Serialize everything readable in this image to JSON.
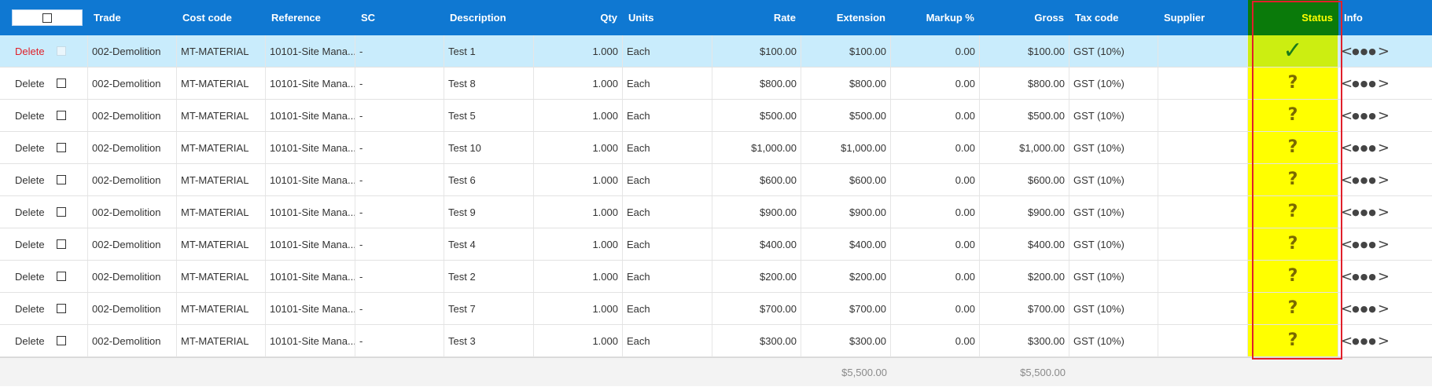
{
  "columns": {
    "trade": "Trade",
    "cost_code": "Cost code",
    "reference": "Reference",
    "sc": "SC",
    "description": "Description",
    "qty": "Qty",
    "units": "Units",
    "rate": "Rate",
    "extension": "Extension",
    "markup": "Markup %",
    "gross": "Gross",
    "tax_code": "Tax code",
    "supplier": "Supplier",
    "status": "Status",
    "info": "Info"
  },
  "delete_label": "Delete",
  "colors": {
    "header_bg": "#0f78d2",
    "status_header_bg": "#0a7a0a",
    "status_header_text": "#ffff00",
    "status_cell_bg": "#ffff00",
    "selected_row_bg": "#c9ecfc",
    "delete_selected": "#e0202a"
  },
  "rows": [
    {
      "trade": "002-Demolition",
      "cost_code": "MT-MATERIAL",
      "reference": "10101-Site Mana...",
      "sc": "-",
      "description": "Test 1",
      "qty": "1.000",
      "units": "Each",
      "rate": "$100.00",
      "extension": "$100.00",
      "markup": "0.00",
      "gross": "$100.00",
      "tax_code": "GST (10%)",
      "supplier": "",
      "status_icon": "check-icon",
      "status_glyph": "✓"
    },
    {
      "trade": "002-Demolition",
      "cost_code": "MT-MATERIAL",
      "reference": "10101-Site Mana...",
      "sc": "-",
      "description": "Test 8",
      "qty": "1.000",
      "units": "Each",
      "rate": "$800.00",
      "extension": "$800.00",
      "markup": "0.00",
      "gross": "$800.00",
      "tax_code": "GST (10%)",
      "supplier": "",
      "status_icon": "question-icon",
      "status_glyph": "?"
    },
    {
      "trade": "002-Demolition",
      "cost_code": "MT-MATERIAL",
      "reference": "10101-Site Mana...",
      "sc": "-",
      "description": "Test 5",
      "qty": "1.000",
      "units": "Each",
      "rate": "$500.00",
      "extension": "$500.00",
      "markup": "0.00",
      "gross": "$500.00",
      "tax_code": "GST (10%)",
      "supplier": "",
      "status_icon": "question-icon",
      "status_glyph": "?"
    },
    {
      "trade": "002-Demolition",
      "cost_code": "MT-MATERIAL",
      "reference": "10101-Site Mana...",
      "sc": "-",
      "description": "Test 10",
      "qty": "1.000",
      "units": "Each",
      "rate": "$1,000.00",
      "extension": "$1,000.00",
      "markup": "0.00",
      "gross": "$1,000.00",
      "tax_code": "GST (10%)",
      "supplier": "",
      "status_icon": "question-icon",
      "status_glyph": "?"
    },
    {
      "trade": "002-Demolition",
      "cost_code": "MT-MATERIAL",
      "reference": "10101-Site Mana...",
      "sc": "-",
      "description": "Test 6",
      "qty": "1.000",
      "units": "Each",
      "rate": "$600.00",
      "extension": "$600.00",
      "markup": "0.00",
      "gross": "$600.00",
      "tax_code": "GST (10%)",
      "supplier": "",
      "status_icon": "question-icon",
      "status_glyph": "?"
    },
    {
      "trade": "002-Demolition",
      "cost_code": "MT-MATERIAL",
      "reference": "10101-Site Mana...",
      "sc": "-",
      "description": "Test 9",
      "qty": "1.000",
      "units": "Each",
      "rate": "$900.00",
      "extension": "$900.00",
      "markup": "0.00",
      "gross": "$900.00",
      "tax_code": "GST (10%)",
      "supplier": "",
      "status_icon": "question-icon",
      "status_glyph": "?"
    },
    {
      "trade": "002-Demolition",
      "cost_code": "MT-MATERIAL",
      "reference": "10101-Site Mana...",
      "sc": "-",
      "description": "Test 4",
      "qty": "1.000",
      "units": "Each",
      "rate": "$400.00",
      "extension": "$400.00",
      "markup": "0.00",
      "gross": "$400.00",
      "tax_code": "GST (10%)",
      "supplier": "",
      "status_icon": "question-icon",
      "status_glyph": "?"
    },
    {
      "trade": "002-Demolition",
      "cost_code": "MT-MATERIAL",
      "reference": "10101-Site Mana...",
      "sc": "-",
      "description": "Test 2",
      "qty": "1.000",
      "units": "Each",
      "rate": "$200.00",
      "extension": "$200.00",
      "markup": "0.00",
      "gross": "$200.00",
      "tax_code": "GST (10%)",
      "supplier": "",
      "status_icon": "question-icon",
      "status_glyph": "?"
    },
    {
      "trade": "002-Demolition",
      "cost_code": "MT-MATERIAL",
      "reference": "10101-Site Mana...",
      "sc": "-",
      "description": "Test 7",
      "qty": "1.000",
      "units": "Each",
      "rate": "$700.00",
      "extension": "$700.00",
      "markup": "0.00",
      "gross": "$700.00",
      "tax_code": "GST (10%)",
      "supplier": "",
      "status_icon": "question-icon",
      "status_glyph": "?"
    },
    {
      "trade": "002-Demolition",
      "cost_code": "MT-MATERIAL",
      "reference": "10101-Site Mana...",
      "sc": "-",
      "description": "Test 3",
      "qty": "1.000",
      "units": "Each",
      "rate": "$300.00",
      "extension": "$300.00",
      "markup": "0.00",
      "gross": "$300.00",
      "tax_code": "GST (10%)",
      "supplier": "",
      "status_icon": "question-icon",
      "status_glyph": "?"
    }
  ],
  "totals": {
    "extension": "$5,500.00",
    "gross": "$5,500.00"
  }
}
